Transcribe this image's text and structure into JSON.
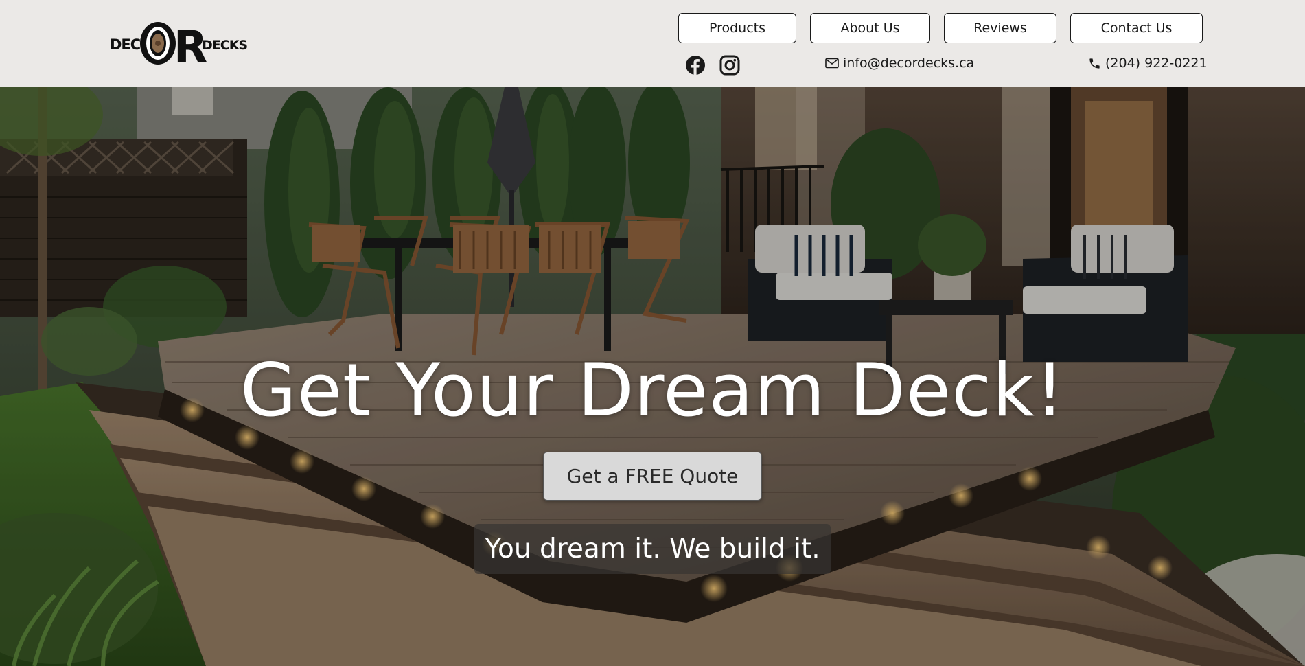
{
  "brand": {
    "logo_text": "DECORDECKS",
    "logo_alt": "Decor Decks logo"
  },
  "nav": {
    "items": [
      {
        "label": "Products"
      },
      {
        "label": "About Us"
      },
      {
        "label": "Reviews"
      },
      {
        "label": "Contact Us"
      }
    ]
  },
  "social": {
    "icons": [
      "facebook-icon",
      "instagram-icon"
    ]
  },
  "contact": {
    "email": "info@decordecks.ca",
    "phone": "(204) 922-0221",
    "email_icon": "envelope-icon",
    "phone_icon": "phone-icon"
  },
  "hero": {
    "title": "Get Your Dream Deck!",
    "cta_label": "Get a FREE Quote",
    "tagline": "You dream it. We build it."
  },
  "colors": {
    "header_bg": "#ebe9e7",
    "text": "#1a1a1a",
    "cta_bg": "#d9d9d9"
  }
}
